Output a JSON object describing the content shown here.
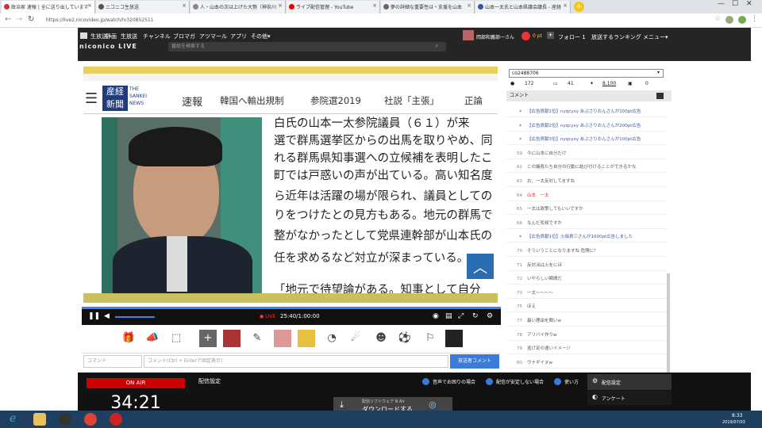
{
  "browser": {
    "tabs": [
      {
        "label": "政治家 速報 | 全に送り出しています"
      },
      {
        "label": "ニコニコ生放送"
      },
      {
        "label": "人・山本の次は上げた大勢（神奈川"
      },
      {
        "label": "ライブ配信管理 - YouTube"
      },
      {
        "label": "夢の詳細な重要性は・支援を山本"
      },
      {
        "label": "山本一太氏と山本県議会議長 - 産経"
      }
    ],
    "new_tab": "+",
    "url": "https://live2.nicovideo.jp/watch/lv320852511"
  },
  "nico_header": {
    "nav": [
      "生放送",
      "静画",
      "生放送",
      "チャンネル",
      "ブロマガ",
      "アツマール",
      "アプリ",
      "その他▾"
    ],
    "logo": "niconico LIVE",
    "search_placeholder": "番組を検索する",
    "user_name": "岡部和義部一さん",
    "points": "0 pt",
    "follow": "フォロー 1",
    "broadcast": "放送する",
    "ranking": "ランキング",
    "menu": "メニュー▾"
  },
  "video": {
    "sankei_brand_1": "THE",
    "sankei_brand_2": "SANKEI",
    "sankei_brand_3": "NEWS",
    "sankei_nav": [
      "速報",
      "韓国へ輸出規制",
      "参院選2019",
      "社説「主張」",
      "正論"
    ],
    "article_lines": [
      "白氏の山本一太参院議員（６１）が来",
      "選で群馬選挙区からの出馬を取りやめ、同",
      "れる群馬県知事選への立候補を表明したこ",
      "町では戸惑いの声が出ている。高い知名度",
      "ら近年は活躍の場が限られ、議員としての",
      "りをつけたとの見方もある。地元の群馬で",
      "整がなかったとして党県連幹部が山本氏の",
      "任を求めるなど対立が深まっている。",
      "「地元で待望論がある。知事として自分"
    ],
    "time": "25:40/1:00:00",
    "live_label": "● LIVE"
  },
  "actions": {
    "command_placeholder": "コマンド",
    "comment_placeholder": "コメント(Ctrl + Enterで固定表示)",
    "submit": "放送者コメント"
  },
  "right_panel": {
    "select_value": "co2488706",
    "stats": [
      "172",
      "41",
      "8,100",
      "0"
    ],
    "comment_header": "コメント",
    "comments": [
      {
        "num": "",
        "text": "【広告貢献1位】nyqcyxy あぶさりおんさんが100pt広告",
        "ad": true
      },
      {
        "num": "",
        "text": "【広告貢献2位】nyqcyxy あぶさりおんさんが200pt広告",
        "ad": true
      },
      {
        "num": "",
        "text": "【広告貢献3位】nyqcyxy あぶさりおんさんが100pt広告",
        "ad": true
      },
      {
        "num": "59",
        "text": "今に山本に自分だけ",
        "ad": false
      },
      {
        "num": "62",
        "text": "この議員たち自分の行動に結び付けることができるかな",
        "ad": false
      },
      {
        "num": "63",
        "text": "お、一太反対してますね",
        "ad": false
      },
      {
        "num": "64",
        "text": "山本　一太",
        "ad": false,
        "red": true
      },
      {
        "num": "65",
        "text": "一太は政策してもいいですか",
        "ad": false
      },
      {
        "num": "66",
        "text": "なんだ気候ですか",
        "ad": false
      },
      {
        "num": "",
        "text": "【広告貢献1位】火焔貢三さんが1000pt広告しました",
        "ad": true
      },
      {
        "num": "70",
        "text": "そういうことになりますね 危険に！",
        "ad": false
      },
      {
        "num": "71",
        "text": "反対派は火をにほ",
        "ad": false
      },
      {
        "num": "72",
        "text": "いやらしい瞬間だ",
        "ad": false
      },
      {
        "num": "73",
        "text": "一太〜〜〜〜",
        "ad": false
      },
      {
        "num": "75",
        "text": "ほえ",
        "ad": false
      },
      {
        "num": "77",
        "text": "最い理由を聞いw",
        "ad": false
      },
      {
        "num": "78",
        "text": "アリバイ作りw",
        "ad": false
      },
      {
        "num": "79",
        "text": "逃げ足の速いイメージ",
        "ad": false
      },
      {
        "num": "80",
        "text": "ウナギイヌw",
        "ad": false
      }
    ]
  },
  "bottom": {
    "on_air": "ON AIR",
    "clock": "34:21",
    "section_title": "配信設定",
    "help_1": "音声でお困りの場合",
    "help_2": "配信が安定しない場合",
    "help_3": "使い方",
    "download_label_1": "配信ソフトウェア N Air",
    "download_label_2": "ダウンロードする",
    "settings": "配信設定",
    "survey": "アンケート"
  },
  "taskbar": {
    "time": "8:33",
    "date": "2019/07/03"
  }
}
